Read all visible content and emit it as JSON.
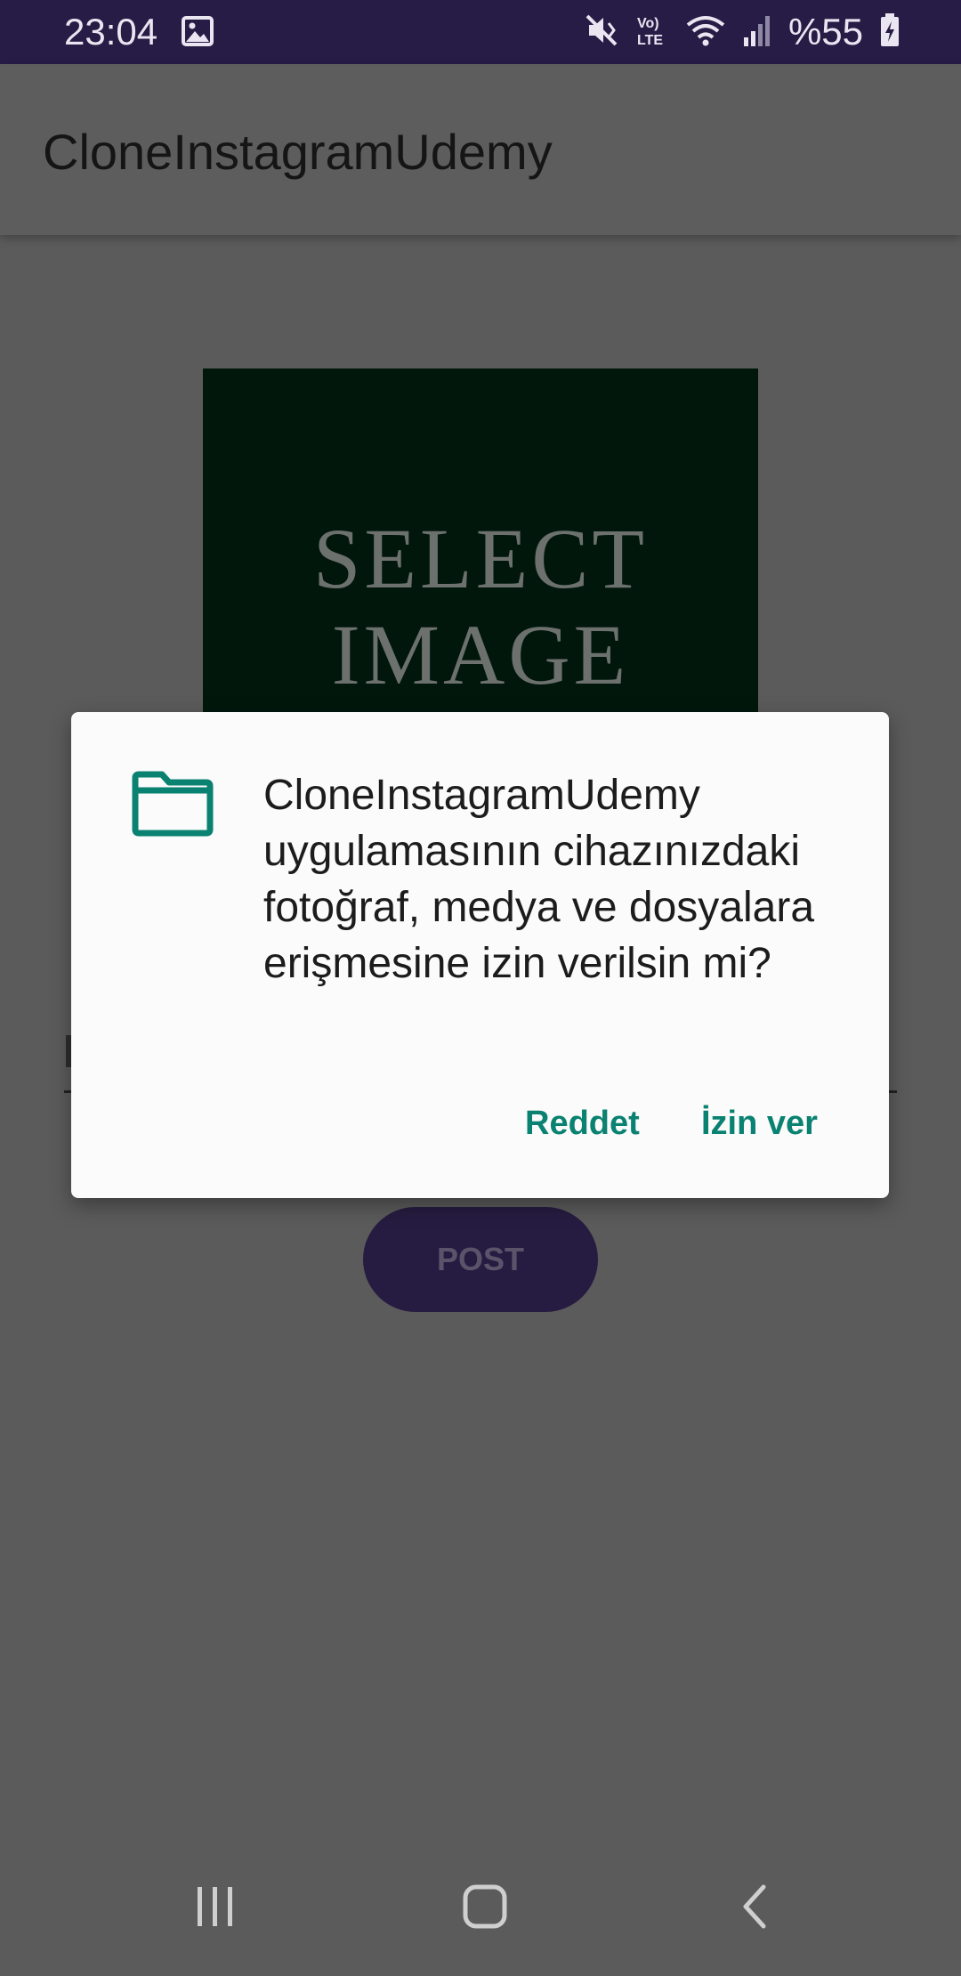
{
  "status_bar": {
    "time": "23:04",
    "battery": "%55",
    "network_label": "Vo) LTE",
    "icons": [
      "image-icon",
      "mute-icon",
      "volte-icon",
      "wifi-icon",
      "signal-icon",
      "battery-charging-icon"
    ]
  },
  "app_bar": {
    "title": "CloneInstagramUdemy"
  },
  "content": {
    "select_image_line1": "SELECT",
    "select_image_line2": "IMAGE",
    "post_label": "POST"
  },
  "dialog": {
    "icon": "folder-icon",
    "message": "CloneInstagramUdemy uygulamasının cihazınızdaki fotoğraf, medya ve dosyalara erişmesine izin verilsin mi?",
    "deny_label": "Reddet",
    "allow_label": "İzin ver"
  },
  "nav_bar": {
    "icons": [
      "recent-apps-icon",
      "home-icon",
      "back-icon"
    ]
  },
  "colors": {
    "status_bar": "#271c46",
    "accent": "#0a8272",
    "scrim": "#5b5b5b",
    "select_image_bg": "#01170c"
  }
}
